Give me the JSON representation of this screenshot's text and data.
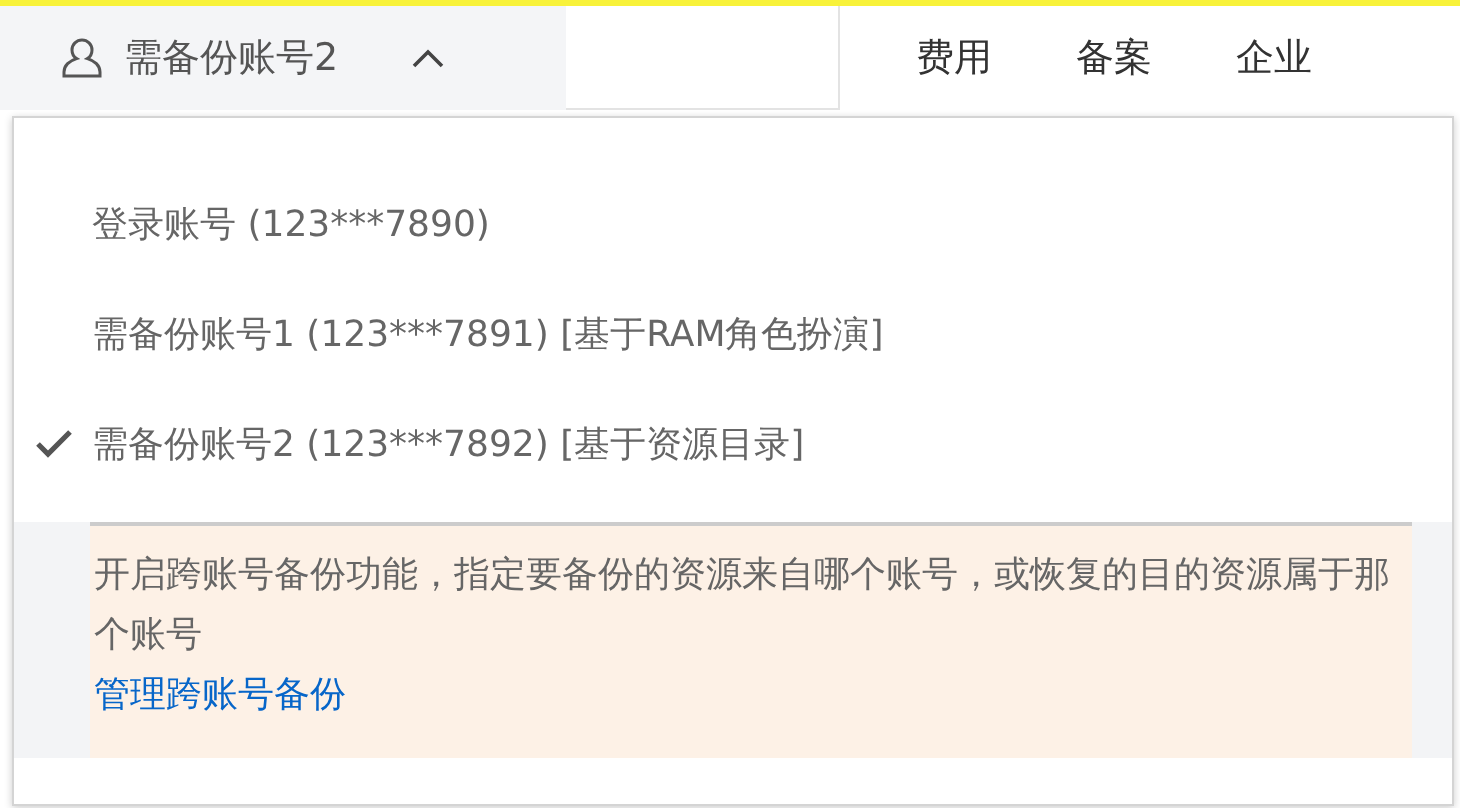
{
  "account_button": {
    "label": "需备份账号2",
    "expanded": true
  },
  "nav": [
    "费用",
    "备案",
    "企业"
  ],
  "accounts": [
    {
      "label": "登录账号 (123***7890)",
      "selected": false
    },
    {
      "label": "需备份账号1 (123***7891) [基于RAM角色扮演]",
      "selected": false
    },
    {
      "label": "需备份账号2 (123***7892) [基于资源目录]",
      "selected": true
    }
  ],
  "notice": {
    "text": "开启跨账号备份功能，指定要备份的资源来自哪个账号，或恢复的目的资源属于那个账号",
    "link": "管理跨账号备份"
  }
}
